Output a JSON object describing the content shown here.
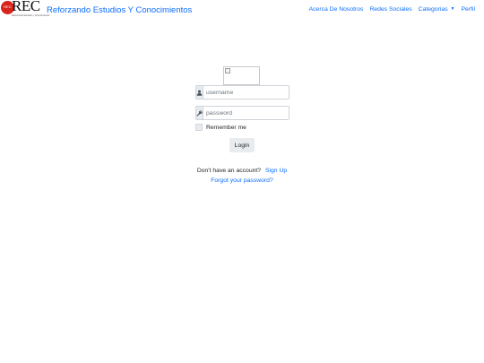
{
  "navbar": {
    "logo_text": "REC",
    "logo_badge": "REC",
    "logo_subtitle": "Reforzando Estudios y Conocimientos",
    "brand": "Reforzando Estudios Y Conocimientos",
    "links": {
      "about": "Acerca De Nosotros",
      "social": "Redes Sociales",
      "categories": "Categorias",
      "profile": "Perfil"
    }
  },
  "login": {
    "username_placeholder": "username",
    "password_placeholder": "password",
    "remember_label": "Remember me",
    "login_button": "Login",
    "no_account_text": "Don't have an account?",
    "signup_link": "Sign Up",
    "forgot_link": "Forgot your password?"
  },
  "icons": {
    "user": "user-icon",
    "key": "key-icon",
    "broken_image": "broken-image-icon",
    "dropdown": "chevron-down-icon"
  },
  "colors": {
    "link": "#0d6efd",
    "logo_red": "#d9241c",
    "addon_bg": "#e9ecef"
  }
}
